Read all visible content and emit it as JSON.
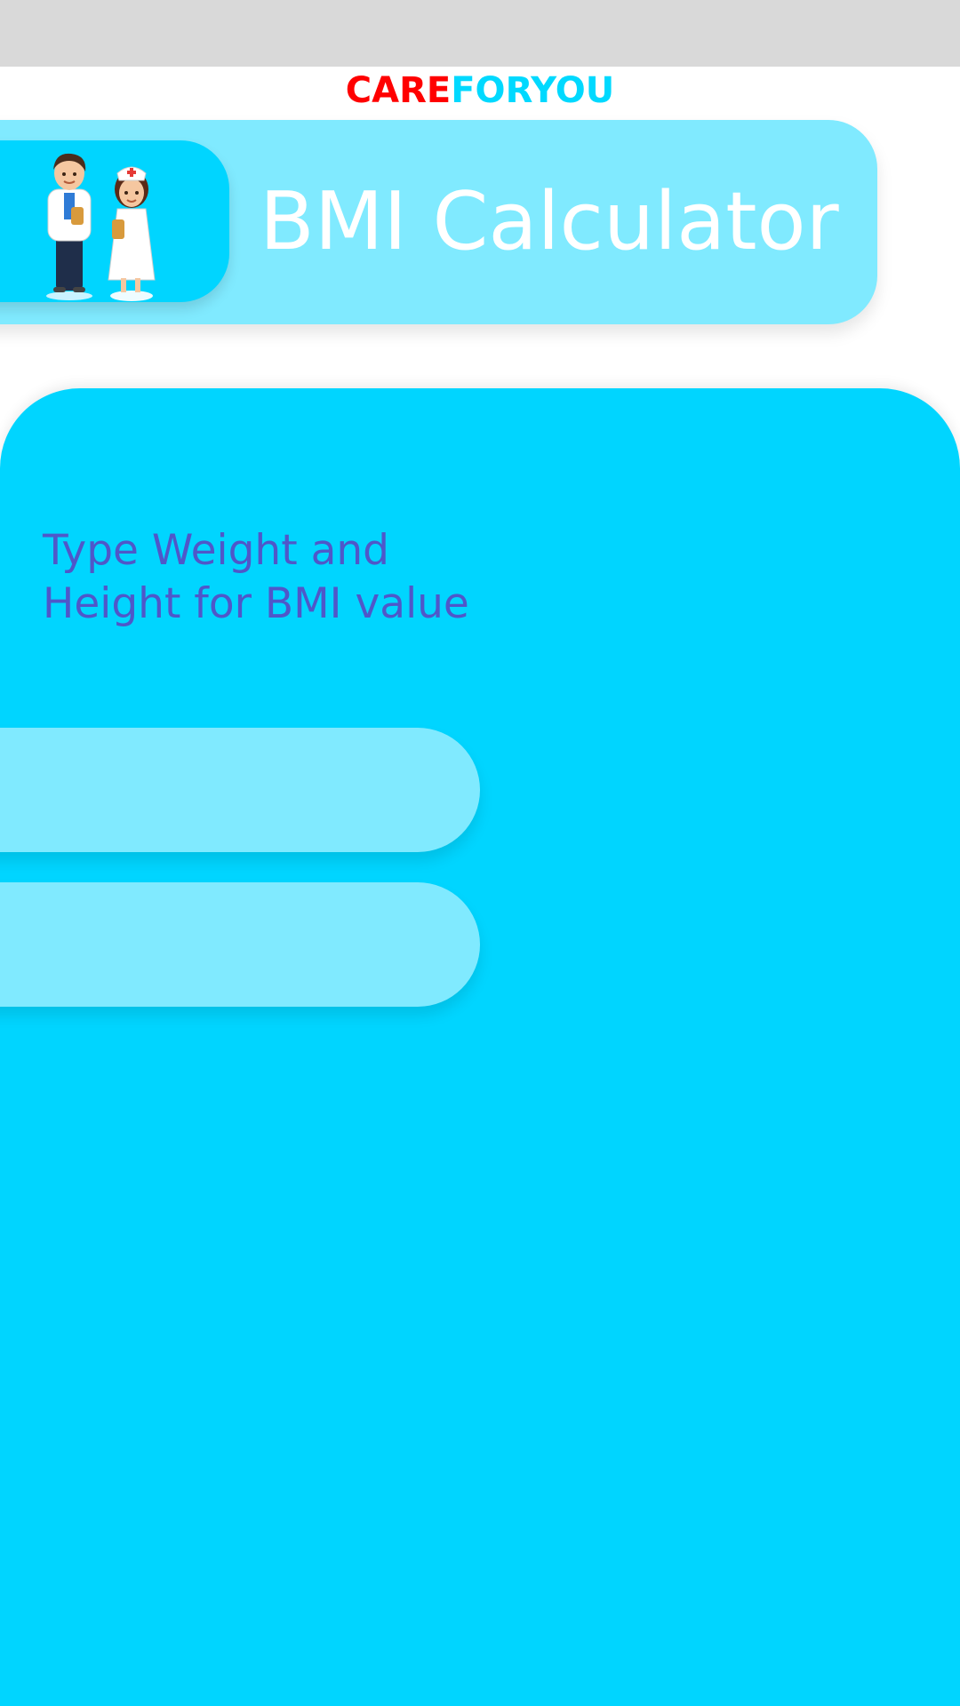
{
  "brand": {
    "part1": "CARE",
    "part2": "FORYOU",
    "part1_color": "#ff0000",
    "part2_color": "#00d9ff"
  },
  "header": {
    "title": "BMI Calculator",
    "illustration_icon": "doctor-and-nurse-icon"
  },
  "main": {
    "instruction_line1": "Type Weight and",
    "instruction_line2": "Height for BMI value",
    "weight_field": {
      "value": "",
      "placeholder": ""
    },
    "height_field": {
      "value": "",
      "placeholder": ""
    }
  },
  "colors": {
    "accent": "#00d5ff",
    "light_accent": "#80eaff",
    "instruction_text": "#4f57c9",
    "status_bar": "#d9d9d9"
  }
}
